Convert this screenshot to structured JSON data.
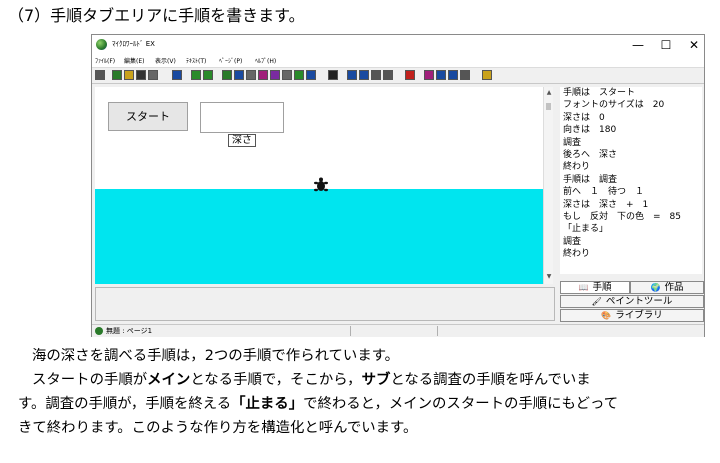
{
  "heading": "（7）手順タブエリアに手順を書きます。",
  "window": {
    "title": "ﾏｲｸﾛﾜｰﾙﾄﾞ EX",
    "controls": {
      "minimize": "—",
      "maximize": "☐",
      "close": "✕"
    },
    "menu": [
      "ﾌｧｲﾙ(F)",
      "編集(E)",
      "表示(V)",
      "ﾃｷｽﾄ(T)",
      "ﾍﾟｰｼﾞ(P)",
      "ﾍﾙﾌﾟ(H)"
    ],
    "toolbar_icons": [
      "pointer-icon",
      "globe-icon",
      "folder-open-icon",
      "save-icon",
      "print-icon",
      "grid-icon",
      "back-icon",
      "forward-icon",
      "turtle-icon",
      "text-icon",
      "pen-icon",
      "eye-icon",
      "music-icon",
      "magic-icon",
      "shape-icon",
      "world-icon",
      "arrow-icon",
      "view-icon",
      "person-icon",
      "zoom-in-icon",
      "zoom-out-icon",
      "stop-icon",
      "draw-icon",
      "copy-icon",
      "paste-icon",
      "undo-icon",
      "help-icon"
    ],
    "stage": {
      "start_button": "スタート",
      "depth_label": "深さ",
      "sea_color": "#00e5ef"
    },
    "procedure_code": [
      "手順は　スタート",
      "フォントのサイズは　20",
      "深さは　0",
      "向きは　180",
      "調査",
      "後ろへ　深さ",
      "終わり",
      "手順は　調査",
      "前へ　１　待つ　１",
      "深さは　深さ　+　1",
      "もし　反対　下の色　=　85",
      "「止まる」",
      "調査",
      "終わり"
    ],
    "tabs": {
      "procedure": "手順",
      "works": "作品",
      "paint_tool": "ペイントツール",
      "library": "ライブラリ"
    },
    "status": "無題 : ページ1"
  },
  "body": {
    "p1": "海の深さを調べる手順は，2つの手順で作られています。",
    "p2a": "スタートの手順が",
    "p2b": "メイン",
    "p2c": "となる手順で，そこから，",
    "p2d": "サブ",
    "p2e": "となる調査の手順を呼んでいま",
    "p3a": "す。調査の手順が，手順を終える",
    "p3b": "「止まる」",
    "p3c": "で終わると，メインのスタートの手順にもどって",
    "p4": "きて終わります。このような作り方を構造化と呼んでいます。"
  }
}
